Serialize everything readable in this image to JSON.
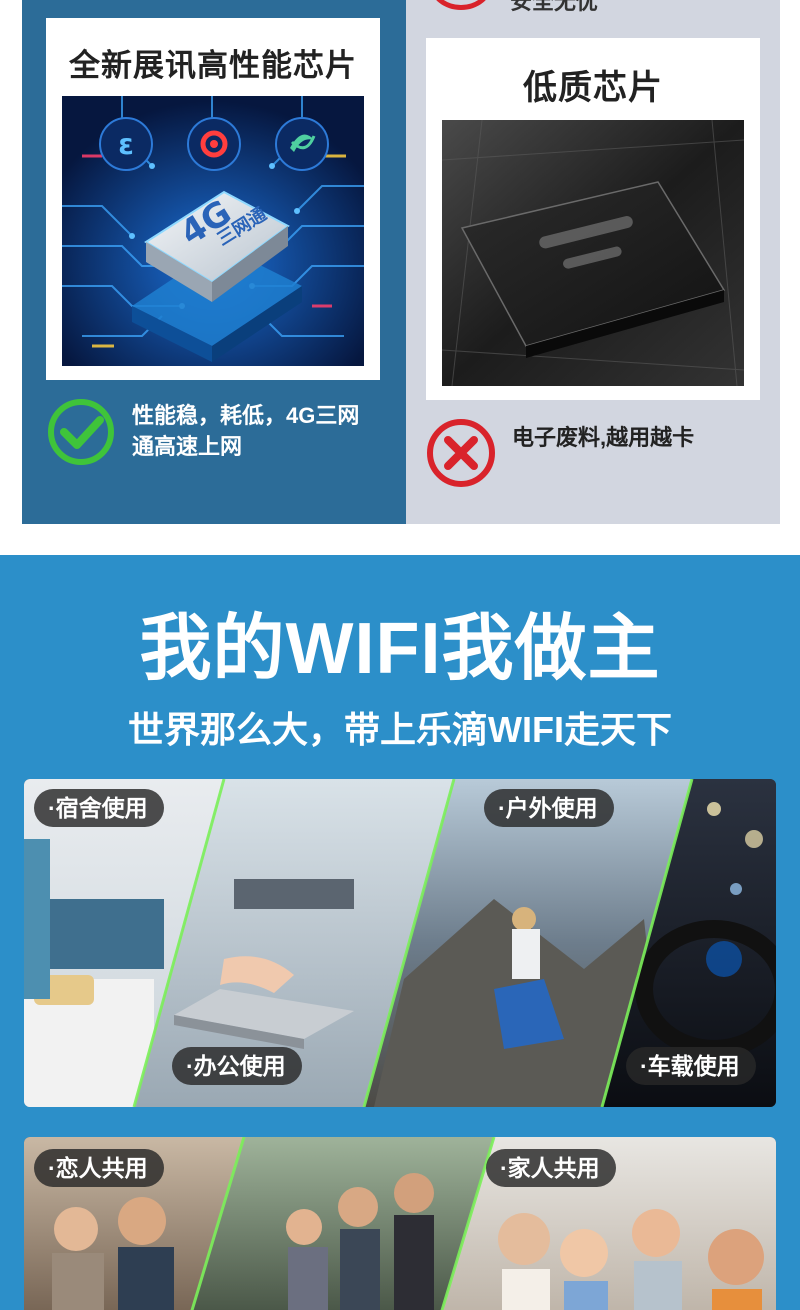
{
  "top_strip": {
    "text": "安全无忧"
  },
  "good_card": {
    "title": "全新展讯高性能芯片",
    "chip_label_main": "4G",
    "chip_label_sub": "三网通",
    "verdict_line1": "性能稳，耗低，4G三网",
    "verdict_line2": "通高速上网"
  },
  "bad_card": {
    "title": "低质芯片",
    "verdict": "电子废料,越用越卡"
  },
  "usage": {
    "title": "我的WIFI我做主",
    "subtitle": "世界那么大，带上乐滴WIFI走天下",
    "scenes": [
      {
        "label": "·宿舍使用"
      },
      {
        "label": "·办公使用"
      },
      {
        "label": "·户外使用"
      },
      {
        "label": "·车载使用"
      },
      {
        "label": "·恋人共用"
      },
      {
        "label": "·家人共用"
      }
    ]
  },
  "colors": {
    "panel_left": "#2c6c98",
    "panel_right": "#d2d6e0",
    "usage_bg": "#2c8fc9",
    "check_green": "#3fc43a",
    "cross_red": "#d9232b",
    "divider_green": "#7cf05a"
  },
  "icons": {
    "good": "check-circle-icon",
    "bad": "cross-circle-icon",
    "carrier_1": "china-telecom-icon",
    "carrier_2": "china-unicom-icon",
    "carrier_3": "china-mobile-icon"
  }
}
